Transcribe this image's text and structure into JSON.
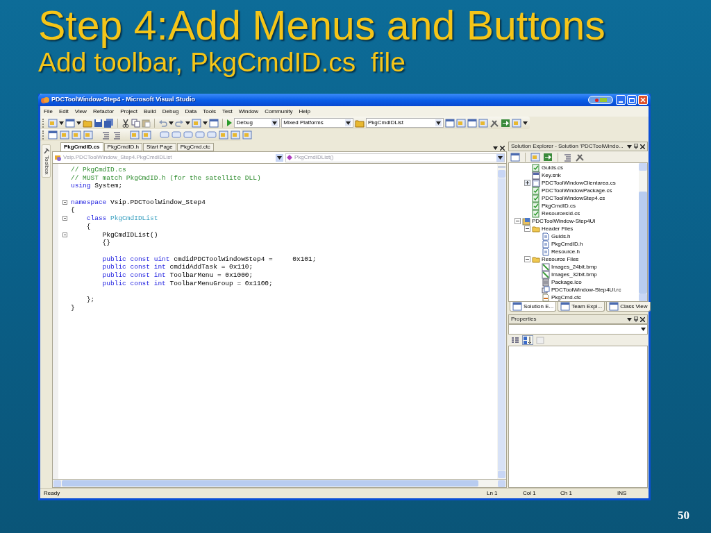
{
  "slide": {
    "title": "Step 4:Add Menus and Buttons",
    "subtitle": "Add toolbar, PkgCmdID.cs  file",
    "page_number": "50"
  },
  "window": {
    "title": "PDCToolWindow-Step4 - Microsoft Visual Studio"
  },
  "menu": [
    "File",
    "Edit",
    "View",
    "Refactor",
    "Project",
    "Build",
    "Debug",
    "Data",
    "Tools",
    "Test",
    "Window",
    "Community",
    "Help"
  ],
  "toolbar": {
    "configuration": "Debug",
    "platform": "Mixed Platforms",
    "find": "PkgCmdIDList"
  },
  "toolbox_tab": "Toolbox",
  "editor": {
    "tabs": [
      {
        "label": "PkgCmdID.cs",
        "selected": true
      },
      {
        "label": "PkgCmdID.h",
        "selected": false
      },
      {
        "label": "Start Page",
        "selected": false
      },
      {
        "label": "PkgCmd.ctc",
        "selected": false
      }
    ],
    "type_combo": "Vsip.PDCToolWindow_Step4.PkgCmdIDList",
    "member_combo": "PkgCmdIDList()",
    "lines": [
      {
        "kind": "code",
        "fold": false,
        "tokens": [
          {
            "text": "// PkgCmdID.cs",
            "kind": "comment"
          }
        ]
      },
      {
        "kind": "code",
        "fold": false,
        "tokens": [
          {
            "text": "// MUST match PkgCmdID.h (for the satellite DLL)",
            "kind": "comment"
          }
        ]
      },
      {
        "kind": "code",
        "fold": false,
        "tokens": [
          {
            "text": "using",
            "kind": "keyword"
          },
          {
            "text": " System;",
            "kind": "plain"
          }
        ]
      },
      {
        "kind": "blank"
      },
      {
        "kind": "code",
        "fold": true,
        "tokens": [
          {
            "text": "namespace",
            "kind": "keyword"
          },
          {
            "text": " Vsip.PDCToolWindow_Step4",
            "kind": "plain"
          }
        ]
      },
      {
        "kind": "code",
        "fold": false,
        "tokens": [
          {
            "text": "{",
            "kind": "plain"
          }
        ]
      },
      {
        "kind": "code",
        "fold": true,
        "tokens": [
          {
            "text": "    class ",
            "kind": "keyword"
          },
          {
            "text": "PkgCmdIDList",
            "kind": "type"
          }
        ]
      },
      {
        "kind": "code",
        "fold": false,
        "tokens": [
          {
            "text": "    {",
            "kind": "plain"
          }
        ]
      },
      {
        "kind": "code",
        "fold": true,
        "tokens": [
          {
            "text": "        PkgCmdIDList()",
            "kind": "plain"
          }
        ]
      },
      {
        "kind": "code",
        "fold": false,
        "tokens": [
          {
            "text": "        {}",
            "kind": "plain"
          }
        ]
      },
      {
        "kind": "blank"
      },
      {
        "kind": "code",
        "fold": false,
        "tokens": [
          {
            "text": "        public const uint",
            "kind": "keyword"
          },
          {
            "text": " cmdidPDCToolWindowStep4 =     0x101;",
            "kind": "plain"
          }
        ]
      },
      {
        "kind": "code",
        "fold": false,
        "tokens": [
          {
            "text": "        public const int",
            "kind": "keyword"
          },
          {
            "text": " cmdidAddTask = 0x110;",
            "kind": "plain"
          }
        ]
      },
      {
        "kind": "code",
        "fold": false,
        "tokens": [
          {
            "text": "        public const int",
            "kind": "keyword"
          },
          {
            "text": " ToolbarMenu = 0x1000;",
            "kind": "plain"
          }
        ]
      },
      {
        "kind": "code",
        "fold": false,
        "tokens": [
          {
            "text": "        public const int",
            "kind": "keyword"
          },
          {
            "text": " ToolbarMenuGroup = 0x1100;",
            "kind": "plain"
          }
        ]
      },
      {
        "kind": "blank"
      },
      {
        "kind": "code",
        "fold": false,
        "tokens": [
          {
            "text": "    };",
            "kind": "plain"
          }
        ]
      },
      {
        "kind": "code",
        "fold": false,
        "tokens": [
          {
            "text": "}",
            "kind": "plain"
          }
        ]
      }
    ]
  },
  "solution_explorer": {
    "title": "Solution Explorer - Solution 'PDCToolWindo...",
    "scrolled_items": [
      {
        "label": "Guids.cs",
        "kind": "cs"
      },
      {
        "label": "Key.snk",
        "kind": "snk"
      },
      {
        "label": "PDCToolWindowClientarea.cs",
        "kind": "form",
        "expanded": false
      },
      {
        "label": "PDCToolWindowPackage.cs",
        "kind": "cs"
      },
      {
        "label": "PDCToolWindowStep4.cs",
        "kind": "cs"
      },
      {
        "label": "PkgCmdID.cs",
        "kind": "cs"
      },
      {
        "label": "ResourcesId.cs",
        "kind": "cs"
      }
    ],
    "tree": [
      {
        "label": "PDCToolWindow-Step4UI",
        "kind": "project",
        "expanded": true,
        "children": [
          {
            "label": "Header Files",
            "kind": "folder",
            "expanded": true,
            "children": [
              {
                "label": "Guids.h",
                "kind": "h"
              },
              {
                "label": "PkgCmdID.h",
                "kind": "h"
              },
              {
                "label": "Resource.h",
                "kind": "h"
              }
            ]
          },
          {
            "label": "Resource Files",
            "kind": "folder",
            "expanded": true,
            "children": [
              {
                "label": "Images_24bit.bmp",
                "kind": "bmp"
              },
              {
                "label": "Images_32bit.bmp",
                "kind": "bmp"
              },
              {
                "label": "Package.ico",
                "kind": "ico"
              },
              {
                "label": "PDCToolWindow-Step4UI.rc",
                "kind": "rc"
              },
              {
                "label": "PkgCmd.ctc",
                "kind": "ctc"
              }
            ]
          }
        ]
      }
    ],
    "tabs": [
      {
        "label": "Solution E...",
        "selected": true
      },
      {
        "label": "Team Expl...",
        "selected": false
      },
      {
        "label": "Class View",
        "selected": false
      }
    ]
  },
  "properties": {
    "title": "Properties",
    "view_buttons": [
      {
        "kind": "categorized",
        "selected": false
      },
      {
        "kind": "alphabetical",
        "selected": true
      },
      {
        "kind": "pages",
        "selected": false
      }
    ]
  },
  "status_bar": {
    "message": "Ready",
    "line": "Ln 1",
    "column": "Col 1",
    "char": "Ch 1",
    "mode": "INS"
  }
}
